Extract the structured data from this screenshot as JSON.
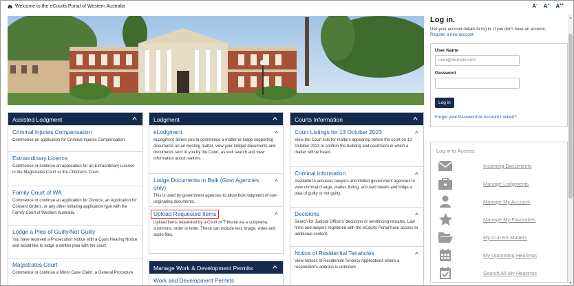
{
  "topbar": {
    "welcome": "Welcome to the eCourts Portal of Western Australia",
    "font_small": "A",
    "font_medium": "A",
    "font_large": "A",
    "font_medium_sign": "+",
    "font_large_sign": "++"
  },
  "hero": {
    "alt": "Supreme Court building of Western Australia"
  },
  "assisted": {
    "title": "Assisted Lodgment",
    "items": [
      {
        "title": "Criminal Injuries Compensation",
        "desc": "Commence an application for Criminal Injuries Compensation."
      },
      {
        "title": "Extraordinary Licence",
        "desc": "Commence or continue an application for an Extraordinary Licence in the Magistrates Court or the Children's Court."
      },
      {
        "title": "Family Court of WA",
        "desc": "Commence or continue an application for Divorce, an Application for Consent Orders, or any other initiating application type with the Family Court of Western Australia."
      },
      {
        "title": "Lodge a Plea of Guilty/Not Guilty",
        "desc": "You have received a Prosecution Notice with a Court Hearing Notice and would like to lodge a written plea with the court."
      },
      {
        "title": "Magistrates Court",
        "desc": "Commence or continue a Minor Case Claim, a General Procedure"
      }
    ]
  },
  "lodgment": {
    "title": "Lodgment",
    "items": [
      {
        "title": "eLodgment",
        "desc": "eLodgment allows you to commence a matter or lodge supporting documents on an existing matter, view your lodged documents and documents sent to you by the Court, as well search and view information about matters."
      },
      {
        "title": "Lodge Documents in Bulk (Govt Agencies only)",
        "desc": "This is used by government agencies to allow bulk lodgment of non-originating documents."
      },
      {
        "title": "Upload Requested Items",
        "desc": "Upload items requested by a Court or Tribunal via a subpoena, summons, order or letter. These can include text, image, video and audio files."
      }
    ]
  },
  "permits": {
    "title": "Manage Work & Development Permits",
    "items": [
      {
        "title": "Work and Development Permits"
      }
    ]
  },
  "courts": {
    "title": "Courts Information",
    "items": [
      {
        "title": "Court Listings for 13 October 2023",
        "desc": "View the Court lists for matters appearing before the court on 13 October 2023 to confirm the building and courtroom in which a matter will be heard."
      },
      {
        "title": "Criminal Information",
        "desc": "Available to accused, lawyers and limited government agencies to view criminal charge, matter, listing, accused details and lodge a plea of guilty or not guilty."
      },
      {
        "title": "Decisions",
        "desc": "Search for Judicial Officers' decisions or sentencing remarks. Law firms and lawyers registered with the eCourts Portal have access to additional content."
      },
      {
        "title": "Notice of Residential Tenancies",
        "desc": "View notices of Residential Tenancy Applications where a respondent's address is unknown"
      }
    ]
  },
  "login": {
    "title": "Log in.",
    "subtitle": "Use your account details to log in. If you don't have an account,",
    "register": "Register a new account.",
    "username_label": "User Name",
    "username_placeholder": "user@domain.com",
    "password_label": "Password",
    "button": "Log in",
    "forgot": "Forgot your Password or Account Locked?"
  },
  "access": {
    "title": "Log in to Access:",
    "items": [
      {
        "label": "Incoming Documents",
        "icon": "envelope-icon"
      },
      {
        "label": "Manage Lodgments",
        "icon": "briefcase-icon"
      },
      {
        "label": "Manage My Account",
        "icon": "user-icon"
      },
      {
        "label": "Manage My Favourites",
        "icon": "star-icon"
      },
      {
        "label": "My Current Matters",
        "icon": "folder-open-icon"
      },
      {
        "label": "My Upcoming Hearings",
        "icon": "calendar-icon"
      },
      {
        "label": "Search All My Hearings",
        "icon": "calendar-check-icon"
      }
    ]
  },
  "colors": {
    "navy": "#152b4e",
    "link": "#1a5a9c",
    "highlight": "#d92a2a"
  }
}
